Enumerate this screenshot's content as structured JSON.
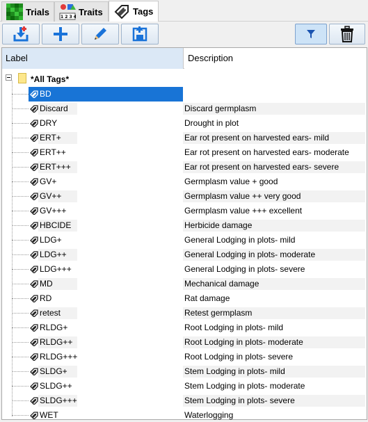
{
  "tabs": [
    {
      "label": "Trials",
      "icon": "trials-grid-icon",
      "active": false
    },
    {
      "label": "Traits",
      "icon": "traits-icon",
      "active": false
    },
    {
      "label": "Tags",
      "icon": "tag-icon",
      "active": true
    }
  ],
  "toolbar": {
    "buttons": [
      "import-icon",
      "add-icon",
      "edit-icon",
      "export-icon"
    ],
    "filter_icon": "filter-icon",
    "delete_icon": "trash-icon"
  },
  "table": {
    "columns": [
      "Label",
      "Description"
    ],
    "root_label": "*All Tags*",
    "rows": [
      {
        "label": "BD",
        "description": ""
      },
      {
        "label": "Discard",
        "description": "Discard germplasm"
      },
      {
        "label": "DRY",
        "description": "Drought in plot"
      },
      {
        "label": "ERT+",
        "description": "Ear rot present on harvested ears- mild"
      },
      {
        "label": "ERT++",
        "description": "Ear rot present on harvested ears- moderate"
      },
      {
        "label": "ERT+++",
        "description": "Ear rot present on harvested ears- severe"
      },
      {
        "label": "GV+",
        "description": "Germplasm value + good"
      },
      {
        "label": "GV++",
        "description": "Germplasm value ++ very good"
      },
      {
        "label": "GV+++",
        "description": "Germplasm value +++ excellent"
      },
      {
        "label": "HBCIDE",
        "description": "Herbicide damage"
      },
      {
        "label": "LDG+",
        "description": "General Lodging in plots- mild"
      },
      {
        "label": "LDG++",
        "description": "General Lodging in plots- moderate"
      },
      {
        "label": "LDG+++",
        "description": "General Lodging in plots- severe"
      },
      {
        "label": "MD",
        "description": "Mechanical damage"
      },
      {
        "label": "RD",
        "description": "Rat damage"
      },
      {
        "label": "retest",
        "description": "Retest germplasm"
      },
      {
        "label": "RLDG+",
        "description": "Root Lodging in plots- mild"
      },
      {
        "label": "RLDG++",
        "description": "Root Lodging in plots- moderate"
      },
      {
        "label": "RLDG+++",
        "description": "Root Lodging in plots- severe"
      },
      {
        "label": "SLDG+",
        "description": "Stem Lodging in plots- mild"
      },
      {
        "label": "SLDG++",
        "description": "Stem Lodging in plots- moderate"
      },
      {
        "label": "SLDG+++",
        "description": "Stem Lodging in plots- severe"
      },
      {
        "label": "WET",
        "description": "Waterlogging"
      }
    ],
    "selected_index": 0
  },
  "colors": {
    "selection": "#1874d6",
    "header_sorted": "#dbe8f6",
    "accent_blue": "#1a73d9"
  }
}
